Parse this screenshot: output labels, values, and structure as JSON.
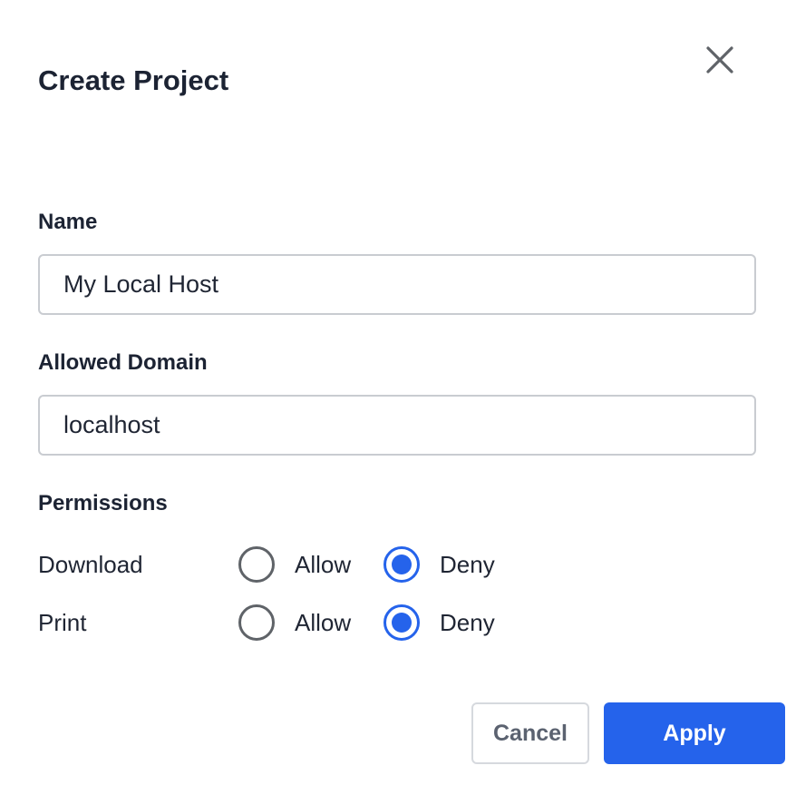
{
  "dialog": {
    "title": "Create Project",
    "close_icon": "close-icon"
  },
  "name_field": {
    "label": "Name",
    "value": "My Local Host"
  },
  "domain_field": {
    "label": "Allowed Domain",
    "value": "localhost"
  },
  "permissions": {
    "heading": "Permissions",
    "rows": [
      {
        "name": "Download",
        "allow_label": "Allow",
        "deny_label": "Deny",
        "selected": "Deny"
      },
      {
        "name": "Print",
        "allow_label": "Allow",
        "deny_label": "Deny",
        "selected": "Deny"
      }
    ]
  },
  "footer": {
    "cancel_label": "Cancel",
    "apply_label": "Apply"
  },
  "colors": {
    "accent": "#2563eb",
    "text": "#1c2333",
    "border": "#c9ccd1"
  }
}
